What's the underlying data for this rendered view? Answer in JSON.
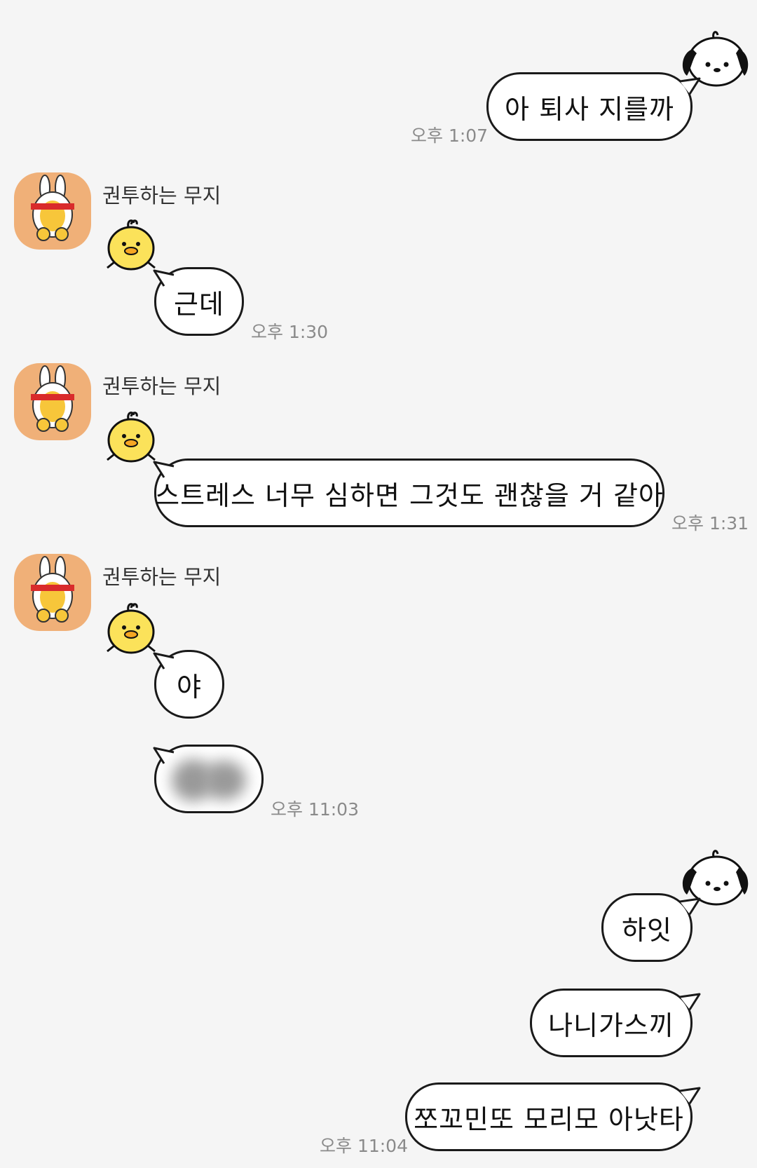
{
  "colors": {
    "background": "#f5f5f5",
    "bubble": "#ffffff",
    "bubble_border": "#1a1a1a",
    "time_text": "#8a8a8a",
    "avatar_bg": "#f0b078"
  },
  "messages": {
    "m1": {
      "text": "아 퇴사 지를까",
      "time": "오후 1:07"
    },
    "g1": {
      "sender": "권투하는 무지",
      "text": "근데",
      "time": "오후 1:30"
    },
    "g2": {
      "sender": "권투하는 무지",
      "text": "스트레스 너무 심하면 그것도 괜찮을 거 같아",
      "time": "오후 1:31"
    },
    "g3": {
      "sender": "권투하는 무지",
      "text": "야",
      "time": "오후 11:03"
    },
    "m2": {
      "text": "하잇"
    },
    "m3": {
      "text": "나니가스끼"
    },
    "m4": {
      "text": "쪼꼬민또 모리모 아낫타",
      "time": "오후 11:04"
    }
  },
  "icons": {
    "other_avatar": "boxing-muzi-rabbit-avatar",
    "chick": "chick-sticker-icon",
    "self_sticker": "white-puppy-icon",
    "blurred": "blurred-content"
  }
}
